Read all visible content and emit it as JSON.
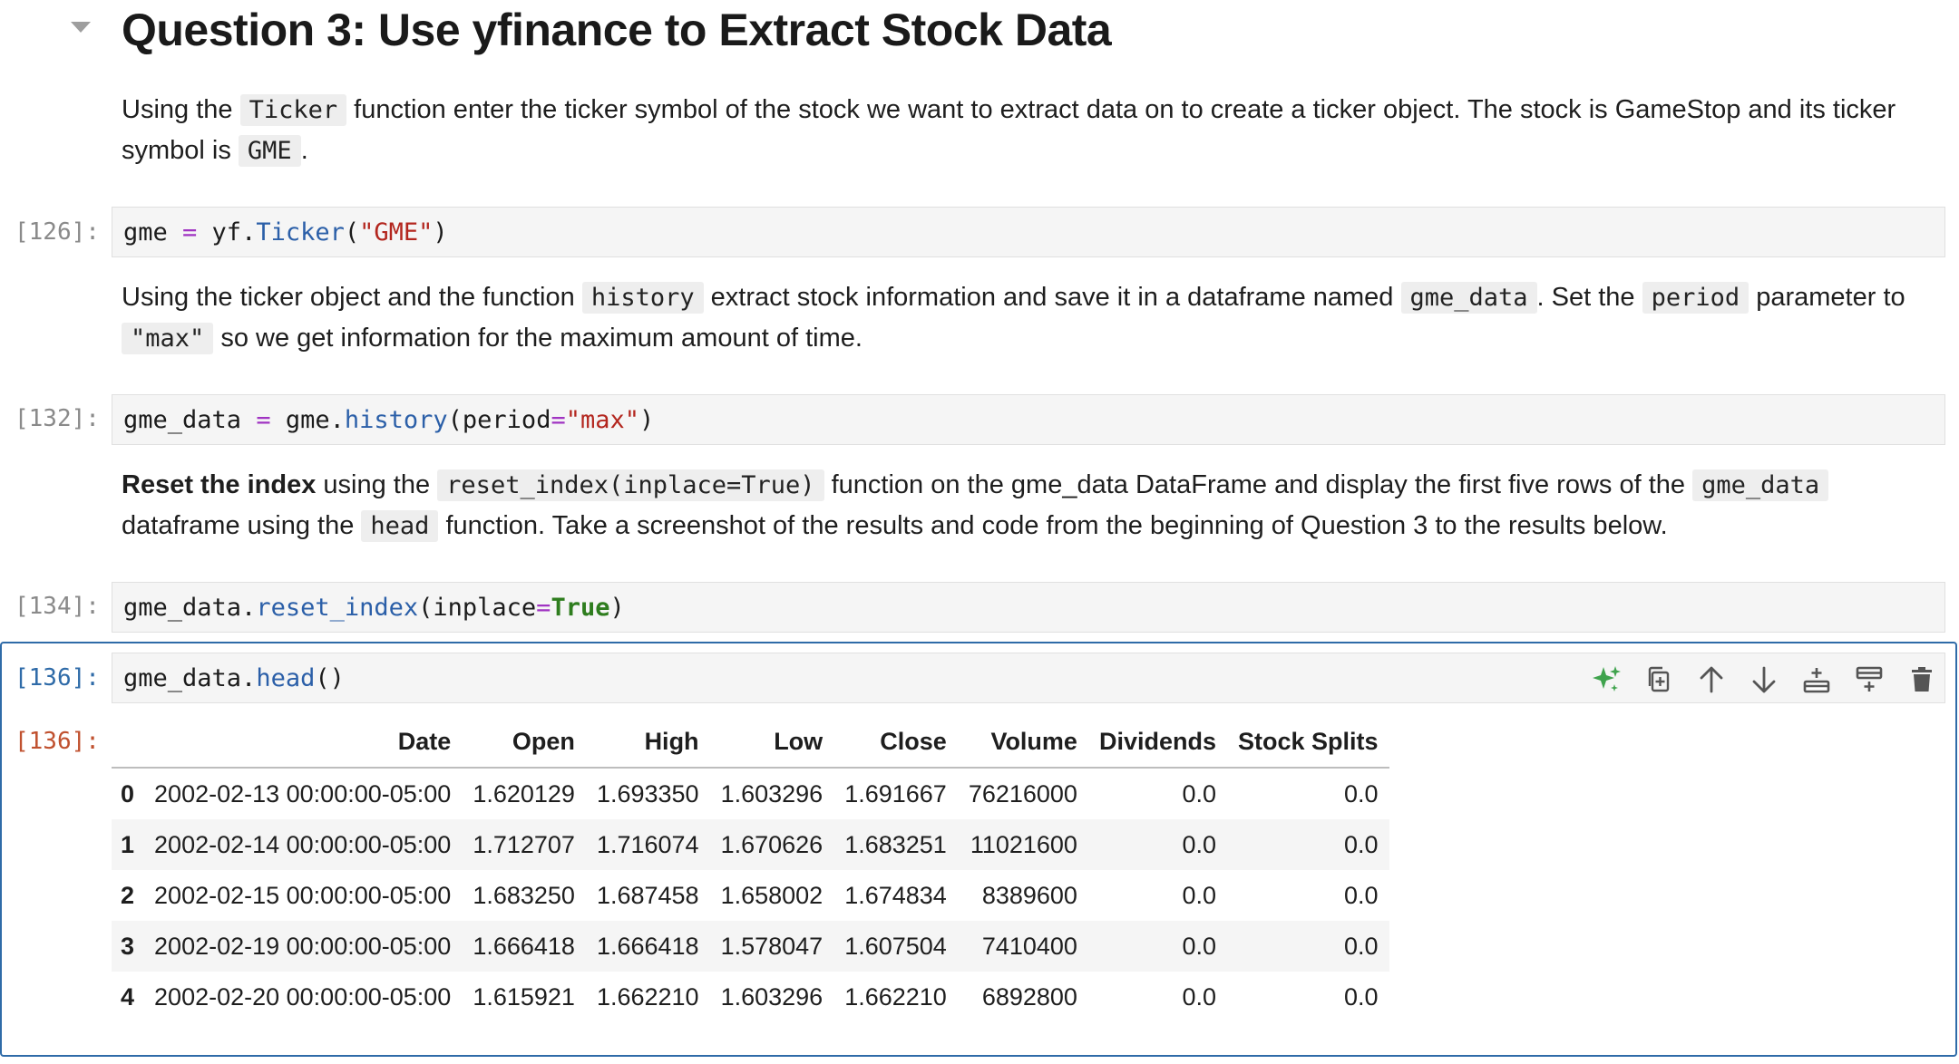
{
  "heading": "Question 3: Use yfinance to Extract Stock Data",
  "para1": {
    "t1": "Using the ",
    "c1": "Ticker",
    "t2": " function enter the ticker symbol of the stock we want to extract data on to create a ticker object. The stock is GameStop and its ticker symbol is ",
    "c2": "GME",
    "t3": "."
  },
  "cell1": {
    "prompt": "[126]:",
    "code": {
      "a": "gme ",
      "op": "=",
      "b": " yf.",
      "fn": "Ticker",
      "c": "(",
      "str": "\"GME\"",
      "d": ")"
    }
  },
  "para2": {
    "t1": "Using the ticker object and the function ",
    "c1": "history",
    "t2": " extract stock information and save it in a dataframe named ",
    "c2": "gme_data",
    "t3": ". Set the ",
    "c3": "period",
    "t4": " parameter to ",
    "c4": "\"max\"",
    "t5": " so we get information for the maximum amount of time."
  },
  "cell2": {
    "prompt": "[132]:",
    "code": {
      "a": "gme_data ",
      "op": "=",
      "b": " gme.",
      "fn": "history",
      "c": "(period",
      "op2": "=",
      "str": "\"max\"",
      "d": ")"
    }
  },
  "para3": {
    "b1": "Reset the index",
    "t1": " using the ",
    "c1": "reset_index(inplace=True)",
    "t2": " function on the gme_data DataFrame and display the first five rows of the ",
    "c2": "gme_data",
    "t3": " dataframe using the ",
    "c3": "head",
    "t4": " function. Take a screenshot of the results and code from the beginning of Question 3 to the results below."
  },
  "cell3": {
    "prompt": "[134]:",
    "code": {
      "a": "gme_data.",
      "fn": "reset_index",
      "c": "(inplace",
      "op": "=",
      "kw": "True",
      "d": ")"
    }
  },
  "cell4": {
    "prompt": "[136]:",
    "out_prompt": "[136]:",
    "code": {
      "a": "gme_data.",
      "fn": "head",
      "c": "()"
    }
  },
  "toolbar": {
    "icons": [
      "sparkle-icon",
      "duplicate-icon",
      "arrow-up-icon",
      "arrow-down-icon",
      "insert-below-icon",
      "insert-above-icon",
      "delete-icon"
    ],
    "accent": "#3fa34d"
  },
  "table": {
    "columns": [
      "Date",
      "Open",
      "High",
      "Low",
      "Close",
      "Volume",
      "Dividends",
      "Stock Splits"
    ],
    "rows": [
      {
        "idx": "0",
        "cells": [
          "2002-02-13 00:00:00-05:00",
          "1.620129",
          "1.693350",
          "1.603296",
          "1.691667",
          "76216000",
          "0.0",
          "0.0"
        ]
      },
      {
        "idx": "1",
        "cells": [
          "2002-02-14 00:00:00-05:00",
          "1.712707",
          "1.716074",
          "1.670626",
          "1.683251",
          "11021600",
          "0.0",
          "0.0"
        ]
      },
      {
        "idx": "2",
        "cells": [
          "2002-02-15 00:00:00-05:00",
          "1.683250",
          "1.687458",
          "1.658002",
          "1.674834",
          "8389600",
          "0.0",
          "0.0"
        ]
      },
      {
        "idx": "3",
        "cells": [
          "2002-02-19 00:00:00-05:00",
          "1.666418",
          "1.666418",
          "1.578047",
          "1.607504",
          "7410400",
          "0.0",
          "0.0"
        ]
      },
      {
        "idx": "4",
        "cells": [
          "2002-02-20 00:00:00-05:00",
          "1.615921",
          "1.662210",
          "1.603296",
          "1.662210",
          "6892800",
          "0.0",
          "0.0"
        ]
      }
    ]
  }
}
